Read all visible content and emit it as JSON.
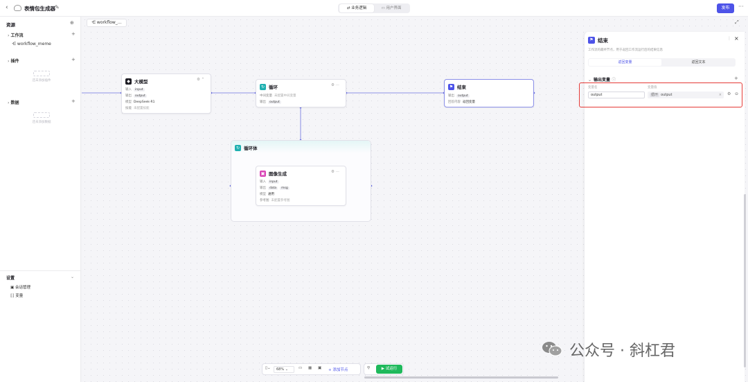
{
  "header": {
    "app_title": "表情包生成器",
    "tabs": [
      "业务逻辑",
      "用户界面"
    ],
    "publish_label": "发布"
  },
  "sidebar": {
    "title": "资源",
    "sections": {
      "workflow": "工作流",
      "plugin": "插件",
      "data": "数据"
    },
    "workflow_item": "workflow_meme",
    "plugin_empty": "还未添加插件",
    "data_empty": "还未添加数据",
    "settings_title": "设置",
    "settings_items": [
      "会话管理",
      "变量"
    ]
  },
  "canvas": {
    "tab_label": "workflow_…",
    "nodes": {
      "llm": {
        "title": "大模型",
        "rows": [
          {
            "label": "输入",
            "value": "input"
          },
          {
            "label": "输出",
            "value": "output"
          },
          {
            "label": "模型",
            "value": "DeepSeek-R1"
          },
          {
            "label": "技能",
            "value": "未配置技能"
          }
        ]
      },
      "loop": {
        "title": "循环",
        "rows": [
          {
            "label": "中间变量",
            "value": "未配置中间变量"
          },
          {
            "label": "输出",
            "value": "output"
          }
        ]
      },
      "end": {
        "title": "结束",
        "rows": [
          {
            "label": "输出",
            "value": "output"
          },
          {
            "label": "回答内容",
            "value": "返回变量"
          }
        ]
      },
      "loop_body": {
        "title": "循环体"
      },
      "image_gen": {
        "title": "图像生成",
        "rows": [
          {
            "label": "输入",
            "value": "input"
          },
          {
            "label": "输出",
            "value": "data",
            "value2": "msg"
          },
          {
            "label": "模型",
            "value": "通用"
          },
          {
            "label": "参考图",
            "value": "未配置参考图"
          }
        ]
      }
    }
  },
  "toolbar": {
    "zoom": "68%",
    "add_node": "添加节点",
    "run": "试运行"
  },
  "panel": {
    "title": "结束",
    "description": "工作流的最终节点，用于返回工作流运行后的结果信息",
    "tabs": [
      "返回变量",
      "返回文本"
    ],
    "section_title": "输出变量",
    "col_name": "变量名",
    "col_value": "变量值",
    "var_name": "output",
    "var_ref_tag": "循环",
    "var_ref": "output"
  },
  "watermark": "公众号 · 斜杠君",
  "colors": {
    "accent": "#4d53e8",
    "run": "#1fb95c",
    "highlight": "#e53935"
  }
}
